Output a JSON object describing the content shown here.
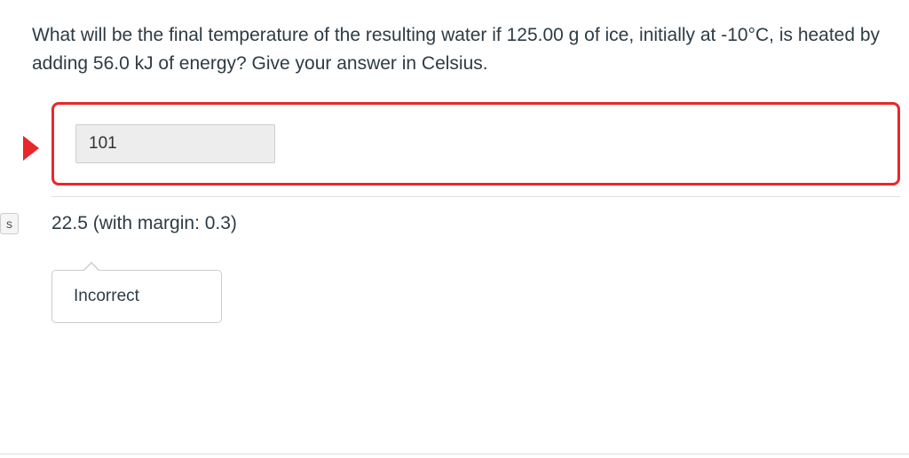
{
  "question": {
    "text": "What will be the final temperature of the resulting water if 125.00 g of ice, initially at -10°C, is heated by adding 56.0 kJ of energy? Give your answer in Celsius."
  },
  "user_answer": {
    "value": "101"
  },
  "correct_answer": {
    "text": "22.5 (with margin: 0.3)"
  },
  "feedback": {
    "text": "Incorrect"
  },
  "badge": {
    "label": "s"
  }
}
